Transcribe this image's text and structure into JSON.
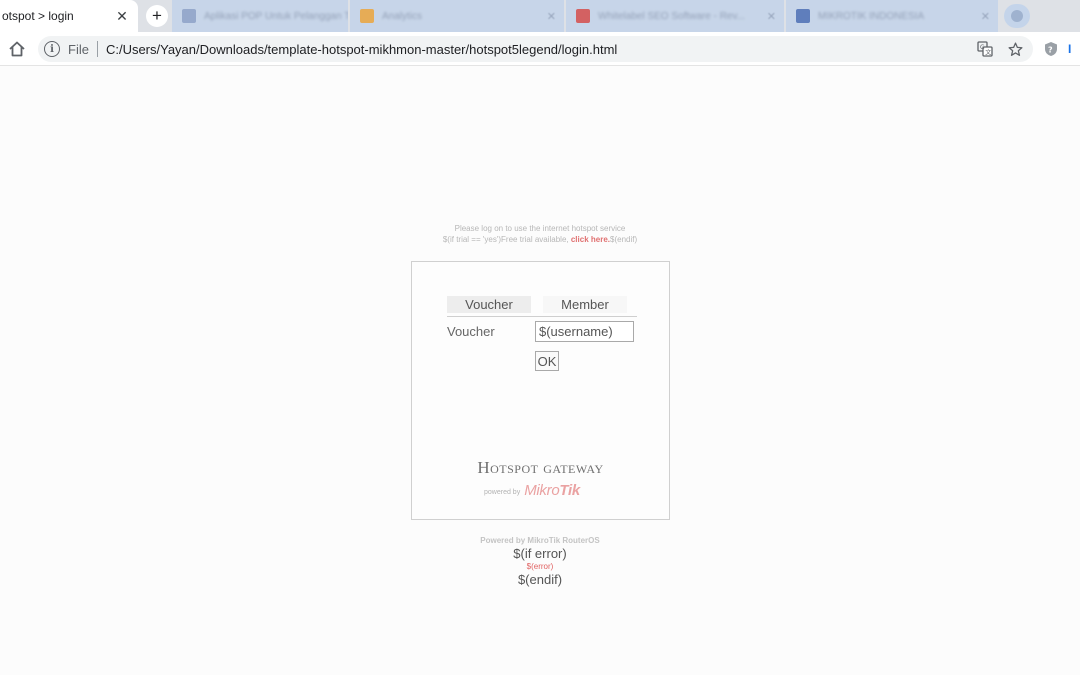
{
  "browser": {
    "active_tab_title": "otspot > login",
    "background_tabs": [
      {
        "title": "Aplikasi POP Untuk Pelanggan T...",
        "favicon_color": "#8aa0c8"
      },
      {
        "title": "Analytics",
        "favicon_color": "#e8a33d"
      },
      {
        "title": "Whitelabel SEO Software - Rev...",
        "favicon_color": "#d24b4b"
      },
      {
        "title": "MIKROTIK INDONESIA",
        "favicon_color": "#4a6db5"
      }
    ],
    "new_tab_symbol": "+",
    "address": {
      "scheme_label": "File",
      "url": "C:/Users/Yayan/Downloads/template-hotspot-mikhmon-master/hotspot5legend/login.html"
    }
  },
  "page": {
    "notice_line1": "Please log on to use the internet hotspot service",
    "notice_line2_prefix": "$(if trial == 'yes')Free trial available, ",
    "notice_link": "click here.",
    "notice_line2_suffix": "$(endif)",
    "tabs": {
      "voucher": "Voucher",
      "member": "Member"
    },
    "voucher_label": "Voucher",
    "username_value": "$(username)",
    "ok_label": "OK",
    "gateway_title": "Hotspot gateway",
    "powered_by_small": "powered by",
    "brand_part1": "Mikro",
    "brand_part2": "Tik",
    "powered_os": "Powered by MikroTik RouterOS",
    "if_error": "$(if error)",
    "error_var": "$(error)",
    "endif": "$(endif)"
  },
  "colors": {
    "link": "#e07070",
    "brand": "#eaa2a2",
    "error": "#e06060"
  }
}
